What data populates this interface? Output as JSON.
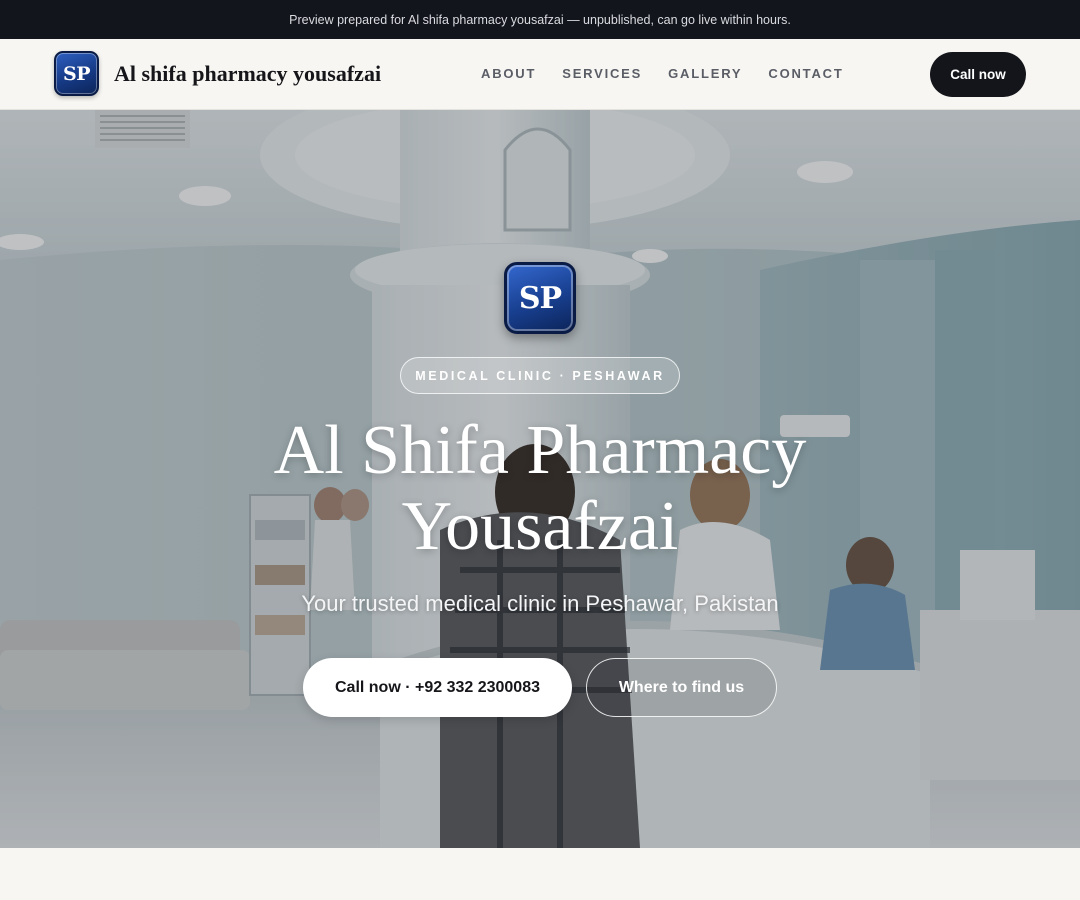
{
  "preview_banner": {
    "text": "Preview prepared for Al shifa pharmacy yousafzai — unpublished, can go live within hours."
  },
  "navbar": {
    "logo_initials": "SP",
    "brand_name": "Al shifa pharmacy yousafzai",
    "links": [
      {
        "label": "ABOUT"
      },
      {
        "label": "SERVICES"
      },
      {
        "label": "GALLERY"
      },
      {
        "label": "CONTACT"
      }
    ],
    "cta_label": "Call now"
  },
  "hero": {
    "logo_initials": "SP",
    "badge": "MEDICAL CLINIC · PESHAWAR",
    "title_line1": "Al Shifa Pharmacy",
    "title_line2": "Yousafzai",
    "subtitle": "Your trusted medical clinic in Peshawar, Pakistan",
    "primary_button": "Call now · +92 332 2300083",
    "secondary_button": "Where to find us"
  },
  "colors": {
    "banner_bg": "#12151b",
    "dark_button": "#13151a",
    "logo_blue": "#183f8f",
    "page_bg": "#f7f6f2"
  }
}
